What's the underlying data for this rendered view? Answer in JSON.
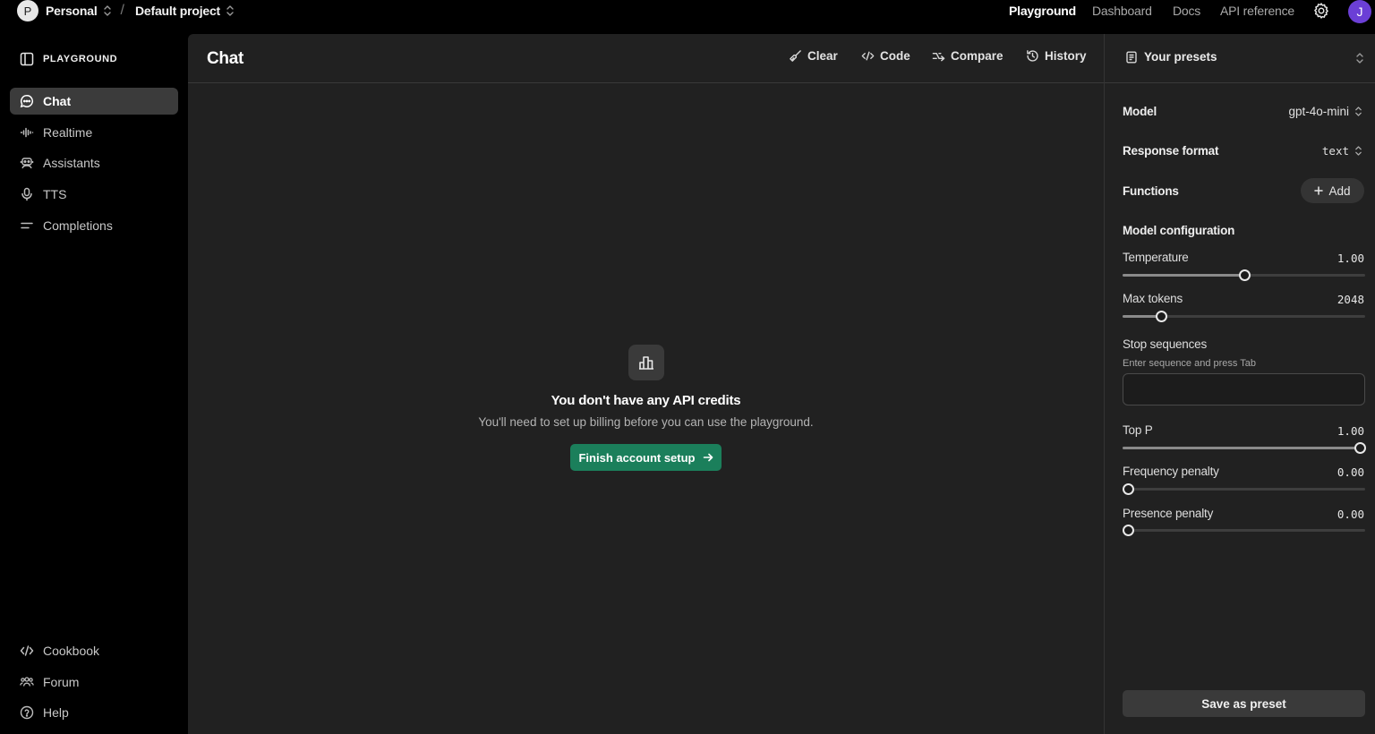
{
  "topbar": {
    "org_initial": "P",
    "org_name": "Personal",
    "separator": "/",
    "project_name": "Default project",
    "nav": [
      "Playground",
      "Dashboard",
      "Docs",
      "API reference"
    ],
    "active_nav": "Playground",
    "settings_icon": "gear-icon",
    "user_initial": "J",
    "user_avatar_color": "#6b3fd6"
  },
  "sidebar": {
    "header": "PLAYGROUND",
    "items": [
      {
        "label": "Chat",
        "icon": "chat-bubble-icon",
        "active": true
      },
      {
        "label": "Realtime",
        "icon": "audio-wave-icon"
      },
      {
        "label": "Assistants",
        "icon": "robot-icon"
      },
      {
        "label": "TTS",
        "icon": "microphone-icon"
      },
      {
        "label": "Completions",
        "icon": "lines-icon"
      }
    ],
    "footer_items": [
      {
        "label": "Cookbook",
        "icon": "code-icon"
      },
      {
        "label": "Forum",
        "icon": "people-icon"
      },
      {
        "label": "Help",
        "icon": "help-circle-icon"
      }
    ]
  },
  "main": {
    "title": "Chat",
    "toolbar": {
      "clear": "Clear",
      "code": "Code",
      "compare": "Compare",
      "history": "History"
    },
    "empty_state": {
      "icon": "bar-chart-icon",
      "title": "You don't have any API credits",
      "subtitle": "You'll need to set up billing before you can use the playground.",
      "button": "Finish account setup",
      "button_color": "#1b7f5b"
    }
  },
  "settings": {
    "presets_label": "Your presets",
    "model_label": "Model",
    "model_value": "gpt-4o-mini",
    "response_format_label": "Response format",
    "response_format_value": "text",
    "functions_label": "Functions",
    "add_label": "Add",
    "model_config_label": "Model configuration",
    "params": {
      "temperature": {
        "label": "Temperature",
        "value": "1.00",
        "fraction": 0.5
      },
      "max_tokens": {
        "label": "Max tokens",
        "value": "2048",
        "fraction": 0.144
      },
      "top_p": {
        "label": "Top P",
        "value": "1.00",
        "fraction": 1.0
      },
      "frequency_penalty": {
        "label": "Frequency penalty",
        "value": "0.00",
        "fraction": 0.0
      },
      "presence_penalty": {
        "label": "Presence penalty",
        "value": "0.00",
        "fraction": 0.0
      }
    },
    "stop_sequences_label": "Stop sequences",
    "stop_sequences_hint": "Enter sequence and press Tab",
    "stop_sequences_value": "",
    "save_preset": "Save as preset"
  }
}
